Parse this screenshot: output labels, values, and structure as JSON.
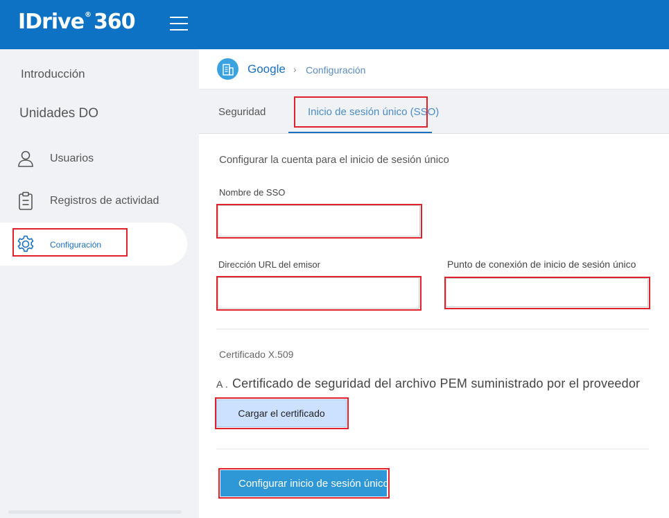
{
  "header": {
    "logo_text": "IDrive",
    "logo_reg": "®",
    "logo_number": "360"
  },
  "sidebar": {
    "items": [
      {
        "label": "Introducción"
      },
      {
        "label": "Unidades DO"
      },
      {
        "label": "Usuarios",
        "icon": "user-icon"
      },
      {
        "label": "Registros de actividad",
        "icon": "clipboard-icon"
      },
      {
        "label": "Configuración",
        "icon": "gear-icon",
        "active": true
      }
    ]
  },
  "breadcrumb": {
    "root": "Google",
    "separator": "›",
    "current": "Configuración"
  },
  "tabs": [
    {
      "label": "Seguridad"
    },
    {
      "label": "Inicio de sesión único (SSO)",
      "active": true
    }
  ],
  "form": {
    "title": "Configurar la cuenta para el inicio de sesión único",
    "sso_name_label": "Nombre de SSO",
    "sso_name_value": "",
    "issuer_url_label": "Dirección URL del emisor",
    "issuer_url_value": "",
    "sso_endpoint_label": "Punto de conexión de inicio de sesión único",
    "sso_endpoint_value": "",
    "cert_label": "Certificado X.509",
    "cert_prefix": "A .",
    "cert_description": "Certificado de seguridad del archivo PEM suministrado por el proveedor",
    "upload_button": "Cargar el certificado",
    "configure_button": "Configurar inicio de sesión único"
  },
  "colors": {
    "brand_blue": "#0e72c4",
    "highlight_red": "#e2202c",
    "primary_button": "#2e97d6",
    "secondary_button": "#cce0ff"
  }
}
